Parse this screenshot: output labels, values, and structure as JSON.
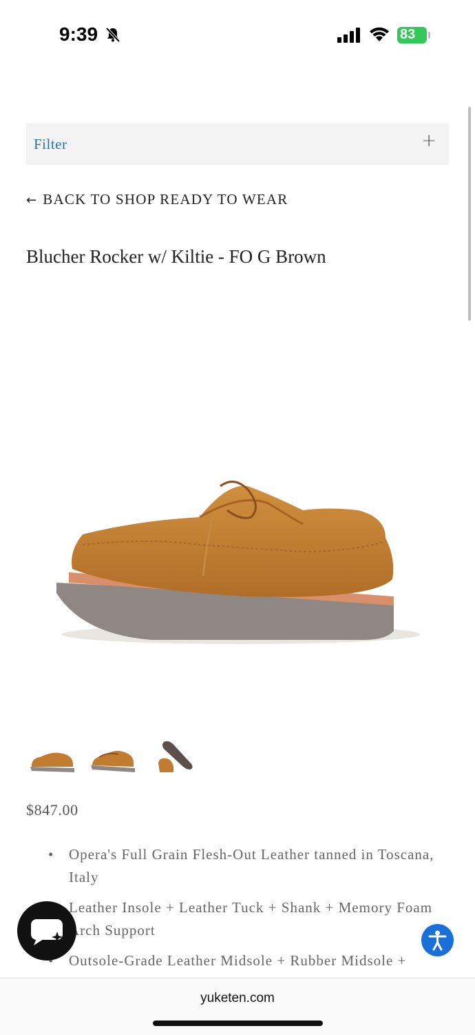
{
  "status_bar": {
    "time": "9:39",
    "battery": "83",
    "icons": [
      "bell-slash-icon",
      "signal-icon",
      "wifi-icon",
      "battery-icon"
    ]
  },
  "filter": {
    "label": "Filter",
    "toggle": "+"
  },
  "back_link": {
    "arrow": "←",
    "label": "BACK TO SHOP READY TO WEAR"
  },
  "product": {
    "title": "Blucher Rocker w/ Kiltie - FO G Brown",
    "price": "$847.00",
    "features": [
      "Opera's Full Grain Flesh-Out Leather tanned in Toscana, Italy",
      "Leather Insole + Leather Tuck + Shank + Memory Foam Arch Support",
      "Outsole-Grade Leather Midsole + Rubber Midsole +"
    ]
  },
  "browser": {
    "url": "yuketen.com"
  },
  "colors": {
    "link_blue": "#2a73a8",
    "accessibility_blue": "#1a6fd8",
    "battery_green": "#34c759"
  }
}
